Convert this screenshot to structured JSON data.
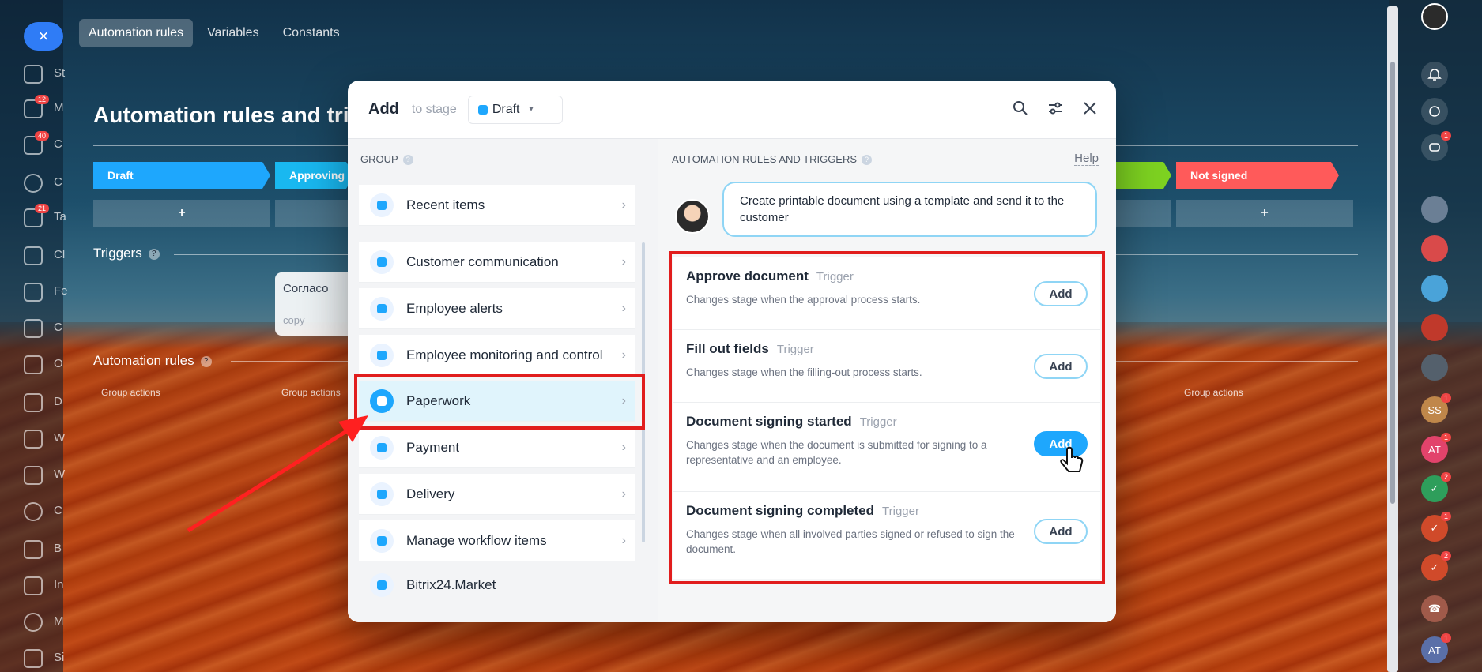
{
  "app": {
    "left_nav": [
      {
        "label": "St"
      },
      {
        "label": "M",
        "badge": "12"
      },
      {
        "label": "C",
        "badge": "40"
      },
      {
        "label": "C"
      },
      {
        "label": "Ta",
        "badge": "21"
      },
      {
        "label": "Cl"
      },
      {
        "label": "Fe"
      },
      {
        "label": "C"
      },
      {
        "label": "O"
      },
      {
        "label": "D"
      },
      {
        "label": "W"
      },
      {
        "label": "W"
      },
      {
        "label": "C"
      },
      {
        "label": "B"
      },
      {
        "label": "In"
      },
      {
        "label": "M"
      },
      {
        "label": "Si"
      }
    ],
    "close_label": "×",
    "right_badges": [
      "1",
      "1",
      "1",
      "2",
      "1",
      "2",
      "1"
    ],
    "right_initials": [
      "SS",
      "AT",
      "AT"
    ]
  },
  "top_tabs": [
    "Automation rules",
    "Variables",
    "Constants"
  ],
  "background": {
    "title": "Automation rules and trig",
    "stages": [
      {
        "label": "Draft",
        "color": "#1ea7fd"
      },
      {
        "label": "Approving",
        "color": "#19b8f0"
      },
      {
        "label": "Not signed",
        "color": "#ff5a5a"
      }
    ],
    "plus": "+",
    "triggers_label": "Triggers",
    "trigger_card": {
      "text": "Согласо",
      "copy": "copy"
    },
    "rules_label": "Automation rules",
    "group_actions": "Group actions"
  },
  "modal": {
    "title": "Add",
    "to_stage": "to stage",
    "stage_value": "Draft",
    "left_title": "GROUP",
    "groups": [
      {
        "label": "Recent items"
      },
      {
        "label": "Customer communication"
      },
      {
        "label": "Employee alerts"
      },
      {
        "label": "Employee monitoring and control"
      },
      {
        "label": "Paperwork",
        "active": true
      },
      {
        "label": "Payment"
      },
      {
        "label": "Delivery"
      },
      {
        "label": "Manage workflow items"
      },
      {
        "label": "Bitrix24.Market"
      }
    ],
    "right_title": "AUTOMATION RULES AND TRIGGERS",
    "help": "Help",
    "bubble": "Create printable document using a template and send it to the customer",
    "triggers": [
      {
        "name": "Approve document",
        "type": "Trigger",
        "desc": "Changes stage when the approval process starts.",
        "button": "Add"
      },
      {
        "name": "Fill out fields",
        "type": "Trigger",
        "desc": "Changes stage when the filling-out process starts.",
        "button": "Add"
      },
      {
        "name": "Document signing started",
        "type": "Trigger",
        "desc": "Changes stage when the document is submitted for signing to a representative and an employee.",
        "button": "Add"
      },
      {
        "name": "Document signing completed",
        "type": "Trigger",
        "desc": "Changes stage when all involved parties signed or refused to sign the document.",
        "button": "Add"
      }
    ]
  },
  "colors": {
    "accent": "#1ea7fd",
    "highlight": "#e11d1d"
  }
}
